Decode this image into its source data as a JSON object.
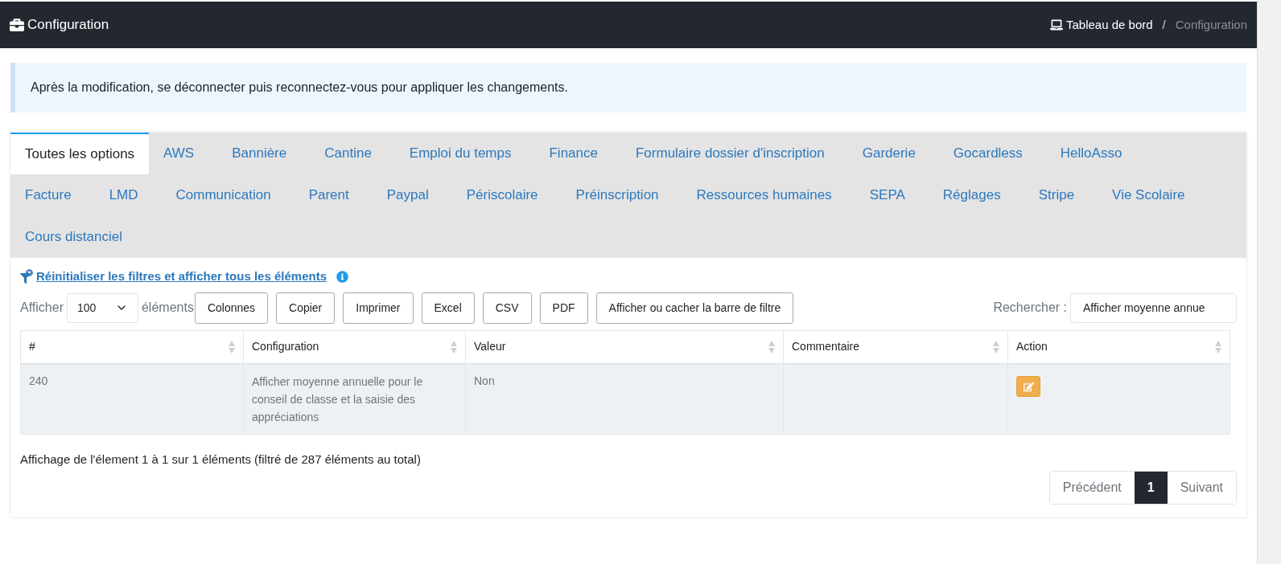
{
  "header": {
    "title": "Configuration",
    "separator": "/",
    "breadcrumb": [
      {
        "label": "Tableau de bord",
        "selected": false
      },
      {
        "label": "Configuration",
        "selected": true
      }
    ]
  },
  "alert": "Après la modification, se déconnecter puis reconnectez-vous pour appliquer les changements.",
  "tabs": [
    {
      "label": "Toutes les options",
      "selected": true
    },
    {
      "label": "AWS",
      "selected": false
    },
    {
      "label": "Bannière",
      "selected": false
    },
    {
      "label": "Cantine",
      "selected": false
    },
    {
      "label": "Emploi du temps",
      "selected": false
    },
    {
      "label": "Finance",
      "selected": false
    },
    {
      "label": "Formulaire dossier d'inscription",
      "selected": false
    },
    {
      "label": "Garderie",
      "selected": false
    },
    {
      "label": "Gocardless",
      "selected": false
    },
    {
      "label": "HelloAsso",
      "selected": false
    },
    {
      "label": "Facture",
      "selected": false
    },
    {
      "label": "LMD",
      "selected": false
    },
    {
      "label": "Communication",
      "selected": false
    },
    {
      "label": "Parent",
      "selected": false
    },
    {
      "label": "Paypal",
      "selected": false
    },
    {
      "label": "Périscolaire",
      "selected": false
    },
    {
      "label": "Préinscription",
      "selected": false
    },
    {
      "label": "Ressources humaines",
      "selected": false
    },
    {
      "label": "SEPA",
      "selected": false
    },
    {
      "label": "Réglages",
      "selected": false
    },
    {
      "label": "Stripe",
      "selected": false
    },
    {
      "label": "Vie Scolaire",
      "selected": false
    },
    {
      "label": "Cours distanciel",
      "selected": false
    }
  ],
  "reset_link": "Réinitialiser les filtres et afficher tous les éléments",
  "length": {
    "before": "Afficher",
    "value": "100",
    "after": "éléments"
  },
  "buttons": [
    "Colonnes",
    "Copier",
    "Imprimer",
    "Excel",
    "CSV",
    "PDF",
    "Afficher ou cacher la barre de filtre"
  ],
  "search": {
    "label": "Rechercher :",
    "value": "Afficher moyenne annue"
  },
  "table": {
    "columns": [
      "#",
      "Configuration",
      "Valeur",
      "Commentaire",
      "Action"
    ],
    "rows": [
      {
        "id": "240",
        "configuration": "Afficher moyenne annuelle pour le conseil de classe et la saisie des appréciations",
        "valeur": "Non",
        "commentaire": ""
      }
    ]
  },
  "info": "Affichage de l'élement 1 à 1 sur 1 éléments (filtré de 287 éléments au total)",
  "pagination": [
    {
      "label": "Précédent",
      "selected": false
    },
    {
      "label": "1",
      "selected": true
    },
    {
      "label": "Suivant",
      "selected": false
    }
  ]
}
